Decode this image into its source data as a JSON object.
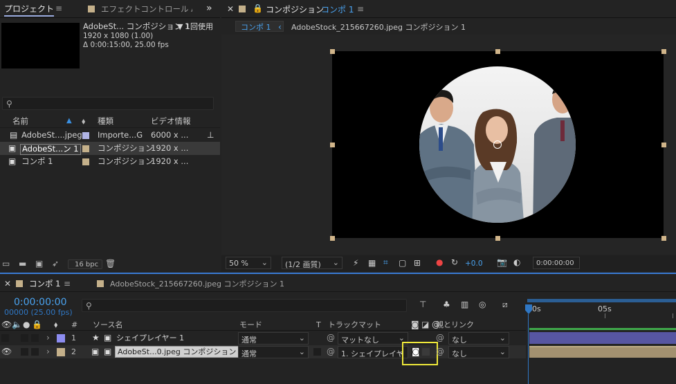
{
  "project": {
    "tab": "プロジェクト",
    "effects_tab": "エフェクトコントロール A",
    "selected_name": "AdobeSt... コンポジション 1",
    "usage": "▼ 1回使用",
    "resolution": "1920 x 1080 (1.00)",
    "duration": "Δ 0:00:15:00, 25.00 fps",
    "search_placeholder": "",
    "col_name": "名前",
    "col_type": "種類",
    "col_video": "ビデオ情報",
    "items": [
      {
        "name": "AdobeSt....jpeg",
        "type": "Importe...G",
        "video": "6000 x ...",
        "color": "#b0b4e4"
      },
      {
        "name": "AdobeSt...ン 1",
        "type": "コンポジション",
        "video": "1920 x ...",
        "color": "#c4b08a"
      },
      {
        "name": "コンポ 1",
        "type": "コンポジション",
        "video": "1920 x ...",
        "color": "#c4b08a"
      }
    ],
    "bpc": "16 bpc"
  },
  "comp": {
    "title": "コンポジション",
    "name": "コンポ 1",
    "crumb_active": "コンポ 1",
    "crumb_next": "AdobeStock_215667260.jpeg コンポジション 1",
    "zoom": "50 %",
    "quality": "(1/2 画質)",
    "exposure": "+0.0",
    "timecode": "0:00:00:00"
  },
  "timeline": {
    "tab1": "コンポ 1",
    "tab2": "AdobeStock_215667260.jpeg コンポジション 1",
    "time": "0:00:00:00",
    "frames": "00000 (25.00 fps)",
    "col_num": "#",
    "col_source": "ソース名",
    "col_mode": "モード",
    "col_t": "T",
    "col_matte": "トラックマット",
    "col_parent": "親とリンク",
    "ruler_start": "00s",
    "ruler_mid": "05s",
    "layers": [
      {
        "num": "1",
        "name": "シェイプレイヤー 1",
        "mode": "通常",
        "matte": "マットなし",
        "parent": "なし",
        "color": "#8c8cf0"
      },
      {
        "num": "2",
        "name": "AdobeSt...0.jpeg コンポジション 1",
        "mode": "通常",
        "matte": "1. シェイプレイヤ",
        "parent": "なし",
        "color": "#c4b08a"
      }
    ]
  }
}
